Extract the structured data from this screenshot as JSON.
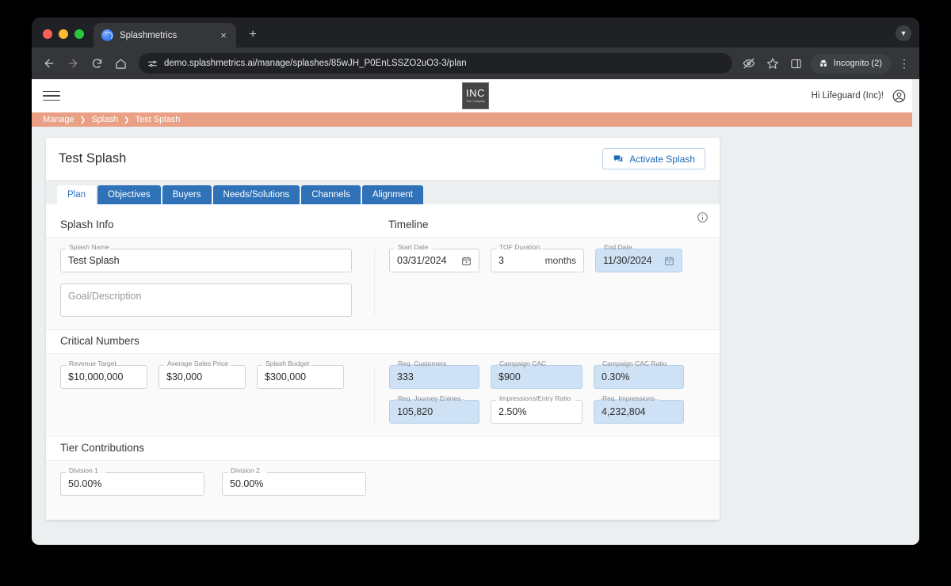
{
  "browser": {
    "tab": {
      "title": "Splashmetrics",
      "favicon": "globe-icon",
      "close": "×"
    },
    "newtab_label": "+",
    "tabstrip_menu": "▼",
    "url": "demo.splashmetrics.ai/manage/splashes/85wJH_P0EnLSSZO2uO3-3/plan",
    "nav": {
      "back": "back-arrow",
      "forward": "forward-arrow",
      "reload": "reload-icon",
      "home": "home-icon"
    },
    "omnibox_icons": [
      "site-settings-icon",
      "hide-password-icon",
      "bookmark-star-icon",
      "side-panel-icon"
    ],
    "incognito_label": "Incognito (2)",
    "menu_label": "⋮"
  },
  "app": {
    "menu_icon": "hamburger-icon",
    "logo": {
      "main": "INC",
      "sub": "Your Company"
    },
    "greeting": "Hi Lifeguard (Inc)!",
    "avatar_icon": "account-circle-icon"
  },
  "breadcrumb": {
    "items": [
      "Manage",
      "Splash",
      "Test Splash"
    ],
    "separator": "❯",
    "background": "#e9a085"
  },
  "header": {
    "title": "Test Splash",
    "activate_label": "Activate Splash",
    "activate_icon": "announcement-icon"
  },
  "tabs": [
    {
      "label": "Plan",
      "active": true
    },
    {
      "label": "Objectives",
      "active": false
    },
    {
      "label": "Buyers",
      "active": false
    },
    {
      "label": "Needs/Solutions",
      "active": false
    },
    {
      "label": "Channels",
      "active": false
    },
    {
      "label": "Alignment",
      "active": false
    }
  ],
  "info_icon": "info-circle-icon",
  "sections": {
    "splash_info": {
      "heading": "Splash Info",
      "name_field": {
        "label": "Splash Name",
        "value": "Test Splash"
      },
      "description_field": {
        "label": "",
        "placeholder": "Goal/Description",
        "value": ""
      }
    },
    "timeline": {
      "heading": "Timeline",
      "fields": [
        {
          "label": "Start Date",
          "value": "03/31/2024",
          "highlighted": false,
          "icon": "calendar-icon"
        },
        {
          "label": "TOF Duration",
          "value": "3",
          "suffix": "months",
          "highlighted": false
        },
        {
          "label": "End Date",
          "value": "11/30/2024",
          "highlighted": true,
          "icon": "calendar-icon"
        }
      ]
    },
    "critical_numbers": {
      "heading": "Critical Numbers",
      "left_fields": [
        {
          "label": "Revenue Target",
          "value": "$10,000,000",
          "highlighted": false
        },
        {
          "label": "Average Sales Price",
          "value": "$30,000",
          "highlighted": false
        },
        {
          "label": "Splash Budget",
          "value": "$300,000",
          "highlighted": false
        }
      ],
      "right_fields_row1": [
        {
          "label": "Req. Customers",
          "value": "333",
          "highlighted": true
        },
        {
          "label": "Campaign CAC",
          "value": "$900",
          "highlighted": true
        },
        {
          "label": "Campaign CAC Ratio",
          "value": "0.30%",
          "highlighted": true
        }
      ],
      "right_fields_row2": [
        {
          "label": "Req. Journey Entries",
          "value": "105,820",
          "highlighted": true
        },
        {
          "label": "Impressions/Entry Ratio",
          "value": "2.50%",
          "highlighted": false
        },
        {
          "label": "Req. Impressions",
          "value": "4,232,804",
          "highlighted": true
        }
      ]
    },
    "tier_contributions": {
      "heading": "Tier Contributions",
      "fields": [
        {
          "label": "Division 1",
          "value": "50.00%",
          "highlighted": false
        },
        {
          "label": "Division 2",
          "value": "50.00%",
          "highlighted": false
        }
      ]
    }
  },
  "colors": {
    "accent_blue": "#2f72b8",
    "breadcrumb_coral": "#e9a085",
    "field_highlight": "#cfe2f5",
    "page_bg": "#eceff0"
  }
}
